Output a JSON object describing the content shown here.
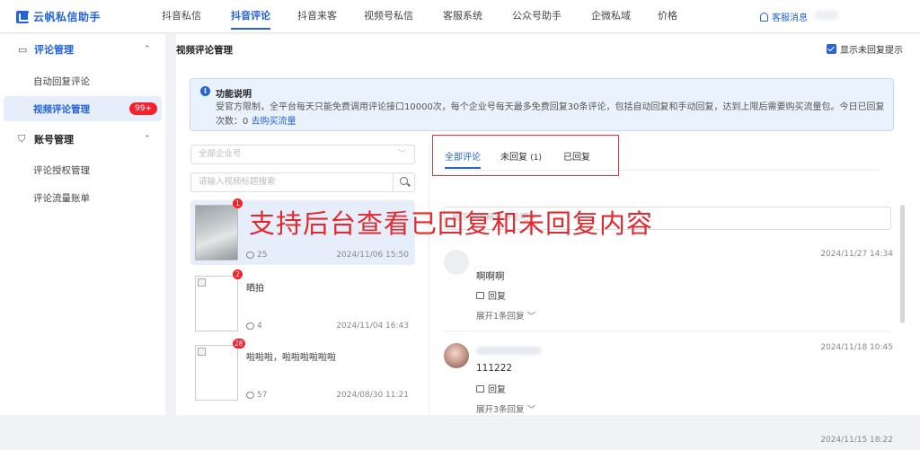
{
  "app": {
    "name": "云帆私信助手",
    "brand_color": "#2563d9"
  },
  "nav": {
    "items": [
      {
        "label": "抖音私信",
        "active": false
      },
      {
        "label": "抖音评论",
        "active": true
      },
      {
        "label": "抖音来客",
        "active": false
      },
      {
        "label": "视频号私信",
        "active": false
      },
      {
        "label": "客服系统",
        "active": false
      },
      {
        "label": "公众号助手",
        "active": false
      },
      {
        "label": "企微私域",
        "active": false
      },
      {
        "label": "价格",
        "active": false
      }
    ],
    "support_label": "客服消息"
  },
  "sidebar": {
    "groups": [
      {
        "label": "评论管理",
        "icon": "comment-icon",
        "expanded": true,
        "items": [
          {
            "label": "自动回复评论",
            "active": false
          },
          {
            "label": "视频评论管理",
            "active": true,
            "badge": "99+"
          }
        ]
      },
      {
        "label": "账号管理",
        "icon": "shield-icon",
        "expanded": true,
        "items": [
          {
            "label": "评论授权管理",
            "active": false
          },
          {
            "label": "评论流量账单",
            "active": false
          }
        ]
      }
    ]
  },
  "main": {
    "title": "视频评论管理",
    "show_unreplied_label": "显示未回复提示",
    "show_unreplied_checked": true,
    "notice": {
      "title": "功能说明",
      "body": "受官方限制，全平台每天只能免费调用评论接口10000次，每个企业号每天最多免费回复30条评论，包括自动回复和手动回复，达到上限后需要购买流量包。今日已回复次数：0",
      "link": "去购买流量"
    },
    "account_select_placeholder": "全部企业号",
    "video_search_placeholder": "请输入视频标题搜索",
    "videos": [
      {
        "badge": "1",
        "title": "",
        "comments": "25",
        "date": "2024/11/06 15:50",
        "active": true
      },
      {
        "badge": "2",
        "title": "晒拍",
        "comments": "4",
        "date": "2024/11/04 16:43",
        "active": false
      },
      {
        "badge": "28",
        "title": "啦啦啦，啦啦啦啦啦啦",
        "comments": "57",
        "date": "2024/08/30 11:21",
        "active": false
      }
    ],
    "tabs": [
      {
        "label": "全部评论",
        "active": true
      },
      {
        "label": "未回复",
        "count": "(1)",
        "active": false
      },
      {
        "label": "已回复",
        "active": false
      }
    ],
    "comment_input_placeholder": "留下你的精彩评论吧~",
    "comments": [
      {
        "date": "2024/11/27 14:34",
        "text": "啊啊啊",
        "reply_label": "回复",
        "expand_label": "展开1条回复"
      },
      {
        "date": "2024/11/18 10:45",
        "text": "111222",
        "reply_label": "回复",
        "expand_label": "展开3条回复"
      },
      {
        "date": "2024/11/15 18:22"
      }
    ]
  },
  "overlay_caption": "支持后台查看已回复和未回复内容",
  "annotation_color": "#e02a2f"
}
